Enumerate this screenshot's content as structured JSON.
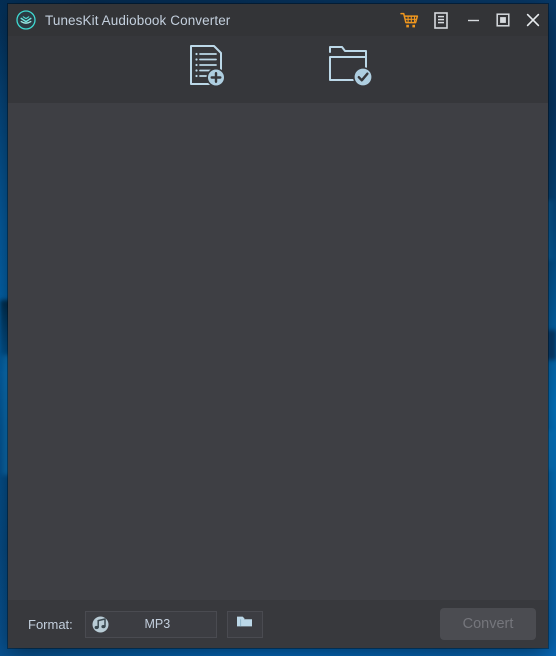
{
  "window": {
    "title": "TunesKit Audiobook Converter",
    "logo_icon": "tuneskit-logo-icon"
  },
  "titlebar": {
    "buttons": [
      {
        "name": "cart-icon",
        "label": "Buy",
        "tooltip": "Buy"
      },
      {
        "name": "log-icon",
        "label": "Log",
        "tooltip": "Log"
      },
      {
        "name": "minimize-icon",
        "label": "Minimize",
        "tooltip": "Minimize"
      },
      {
        "name": "maximize-icon",
        "label": "Maximize",
        "tooltip": "Maximize"
      },
      {
        "name": "close-icon",
        "label": "Close",
        "tooltip": "Close"
      }
    ]
  },
  "toolbar": {
    "add_files_label": "Add Files",
    "add_files_icon": "add-document-list-icon",
    "add_folder_label": "Add Converted Folder",
    "add_folder_icon": "folder-check-icon"
  },
  "file_list": {
    "empty_message": ""
  },
  "bottom_bar": {
    "format_label": "Format:",
    "format_value": "MP3",
    "format_icon": "music-note-icon",
    "output_folder_icon": "folder-icon",
    "convert_label": "Convert",
    "convert_enabled": false
  },
  "colors": {
    "titlebar_bg": "#333437",
    "toolbar_bg": "#36373b",
    "list_bg": "#3e3f44",
    "bottom_bg": "#38393d",
    "text": "#c3cfdd",
    "icon_stroke": "#bcd8e8",
    "cart_accent": "#f0971e",
    "logo_accent": "#3fd8d0",
    "convert_disabled_bg": "#4b4c51",
    "convert_disabled_text": "#75767c",
    "desktop_blue": "#0b5fa8"
  }
}
